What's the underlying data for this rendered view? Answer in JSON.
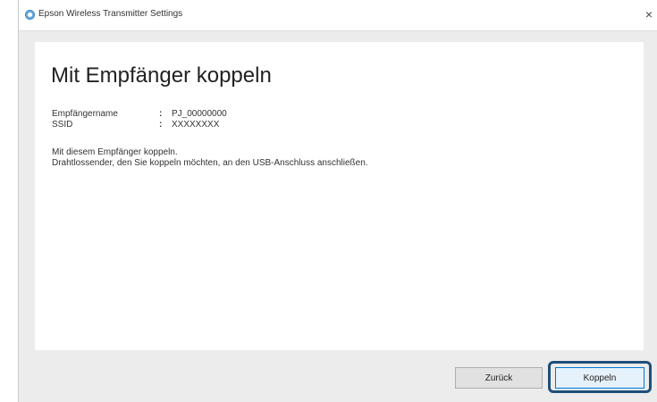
{
  "window": {
    "title": "Epson Wireless Transmitter Settings",
    "close_symbol": "×"
  },
  "main": {
    "heading": "Mit Empfänger koppeln",
    "fields": [
      {
        "label": "Empfängername",
        "separator": ":",
        "value": "PJ_00000000"
      },
      {
        "label": "SSID",
        "separator": ":",
        "value": "XXXXXXXX"
      }
    ],
    "message_line1": "Mit diesem Empfänger koppeln.",
    "message_line2": "Drahtlossender, den Sie koppeln möchten, an den USB-Anschluss anschließen."
  },
  "buttons": {
    "back_label": "Zurück",
    "pair_label": "Koppeln"
  },
  "icons": {
    "app": "epson-app-icon",
    "close": "close-icon"
  },
  "colors": {
    "highlight": "#1f4f7a",
    "focus_border": "#0078d7"
  }
}
